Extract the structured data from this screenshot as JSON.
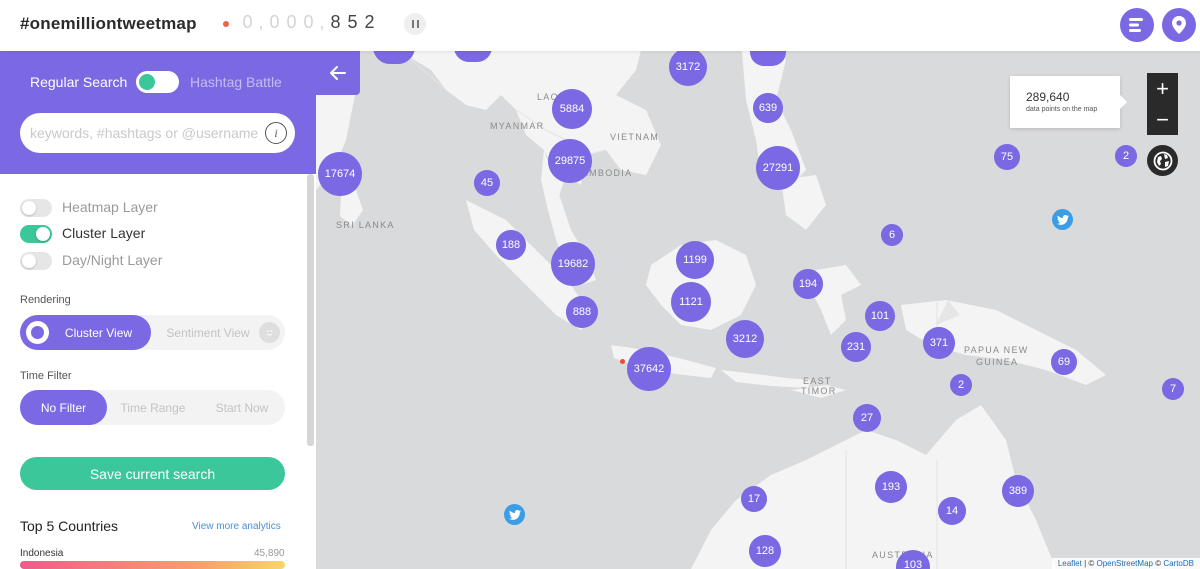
{
  "header": {
    "brand": "#onemilliontweetmap",
    "counter_digits": [
      "0",
      ",",
      "0",
      "0",
      "0",
      ",",
      "8",
      "5",
      "2"
    ],
    "pause_icon": "pause-icon",
    "menu_icon": "list-icon",
    "location_icon": "map-pin-icon"
  },
  "sidebar": {
    "collapse_icon": "arrow-left-icon",
    "search_mode": {
      "regular_label": "Regular Search",
      "hashtag_label": "Hashtag Battle",
      "selected": "Regular Search"
    },
    "search": {
      "placeholder": "keywords, #hashtags or @username",
      "value": ""
    },
    "layers": [
      {
        "label": "Heatmap Layer",
        "on": false
      },
      {
        "label": "Cluster Layer",
        "on": true
      },
      {
        "label": "Day/Night Layer",
        "on": false
      }
    ],
    "rendering": {
      "label": "Rendering",
      "options": [
        "Cluster View",
        "Sentiment View"
      ],
      "selected": "Cluster View"
    },
    "time_filter": {
      "label": "Time Filter",
      "options": [
        "No Filter",
        "Time Range",
        "Start Now"
      ],
      "selected": "No Filter"
    },
    "save_button": "Save current search",
    "top_countries": {
      "title": "Top 5 Countries",
      "link": "View more analytics",
      "items": [
        {
          "name": "Indonesia",
          "count": "45,890"
        }
      ]
    }
  },
  "map": {
    "labels": [
      "MYANMAR",
      "LAOS",
      "VIETNAM",
      "CAMBODIA",
      "SRI LANKA",
      "PAPUA NEW",
      "GUINEA",
      "EAST",
      "TIMOR",
      "AUSTRALIA"
    ],
    "clusters": [
      "3172",
      "639",
      "5884",
      "29875",
      "17674",
      "27291",
      "75",
      "2",
      "45",
      "6",
      "188",
      "19682",
      "1199",
      "194",
      "1121",
      "888",
      "101",
      "3212",
      "231",
      "371",
      "69",
      "37642",
      "2",
      "7",
      "27",
      "193",
      "389",
      "17",
      "14",
      "128",
      "103"
    ],
    "info": {
      "count": "289,640",
      "sub": "data points on the map"
    },
    "zoom_in": "+",
    "zoom_out": "−",
    "globe_icon": "globe-icon",
    "attribution": {
      "leaflet": "Leaflet",
      "sep1": " | © ",
      "osm": "OpenStreetMap",
      "sep2": " © ",
      "carto": "CartoDB"
    },
    "colors": {
      "cluster": "#7b68e3",
      "twitter": "#3b9de6",
      "land": "#f4f4f4",
      "sea": "#d9dadb"
    }
  },
  "accent": "#7b68e3",
  "toggle_on": "#3cc79a"
}
